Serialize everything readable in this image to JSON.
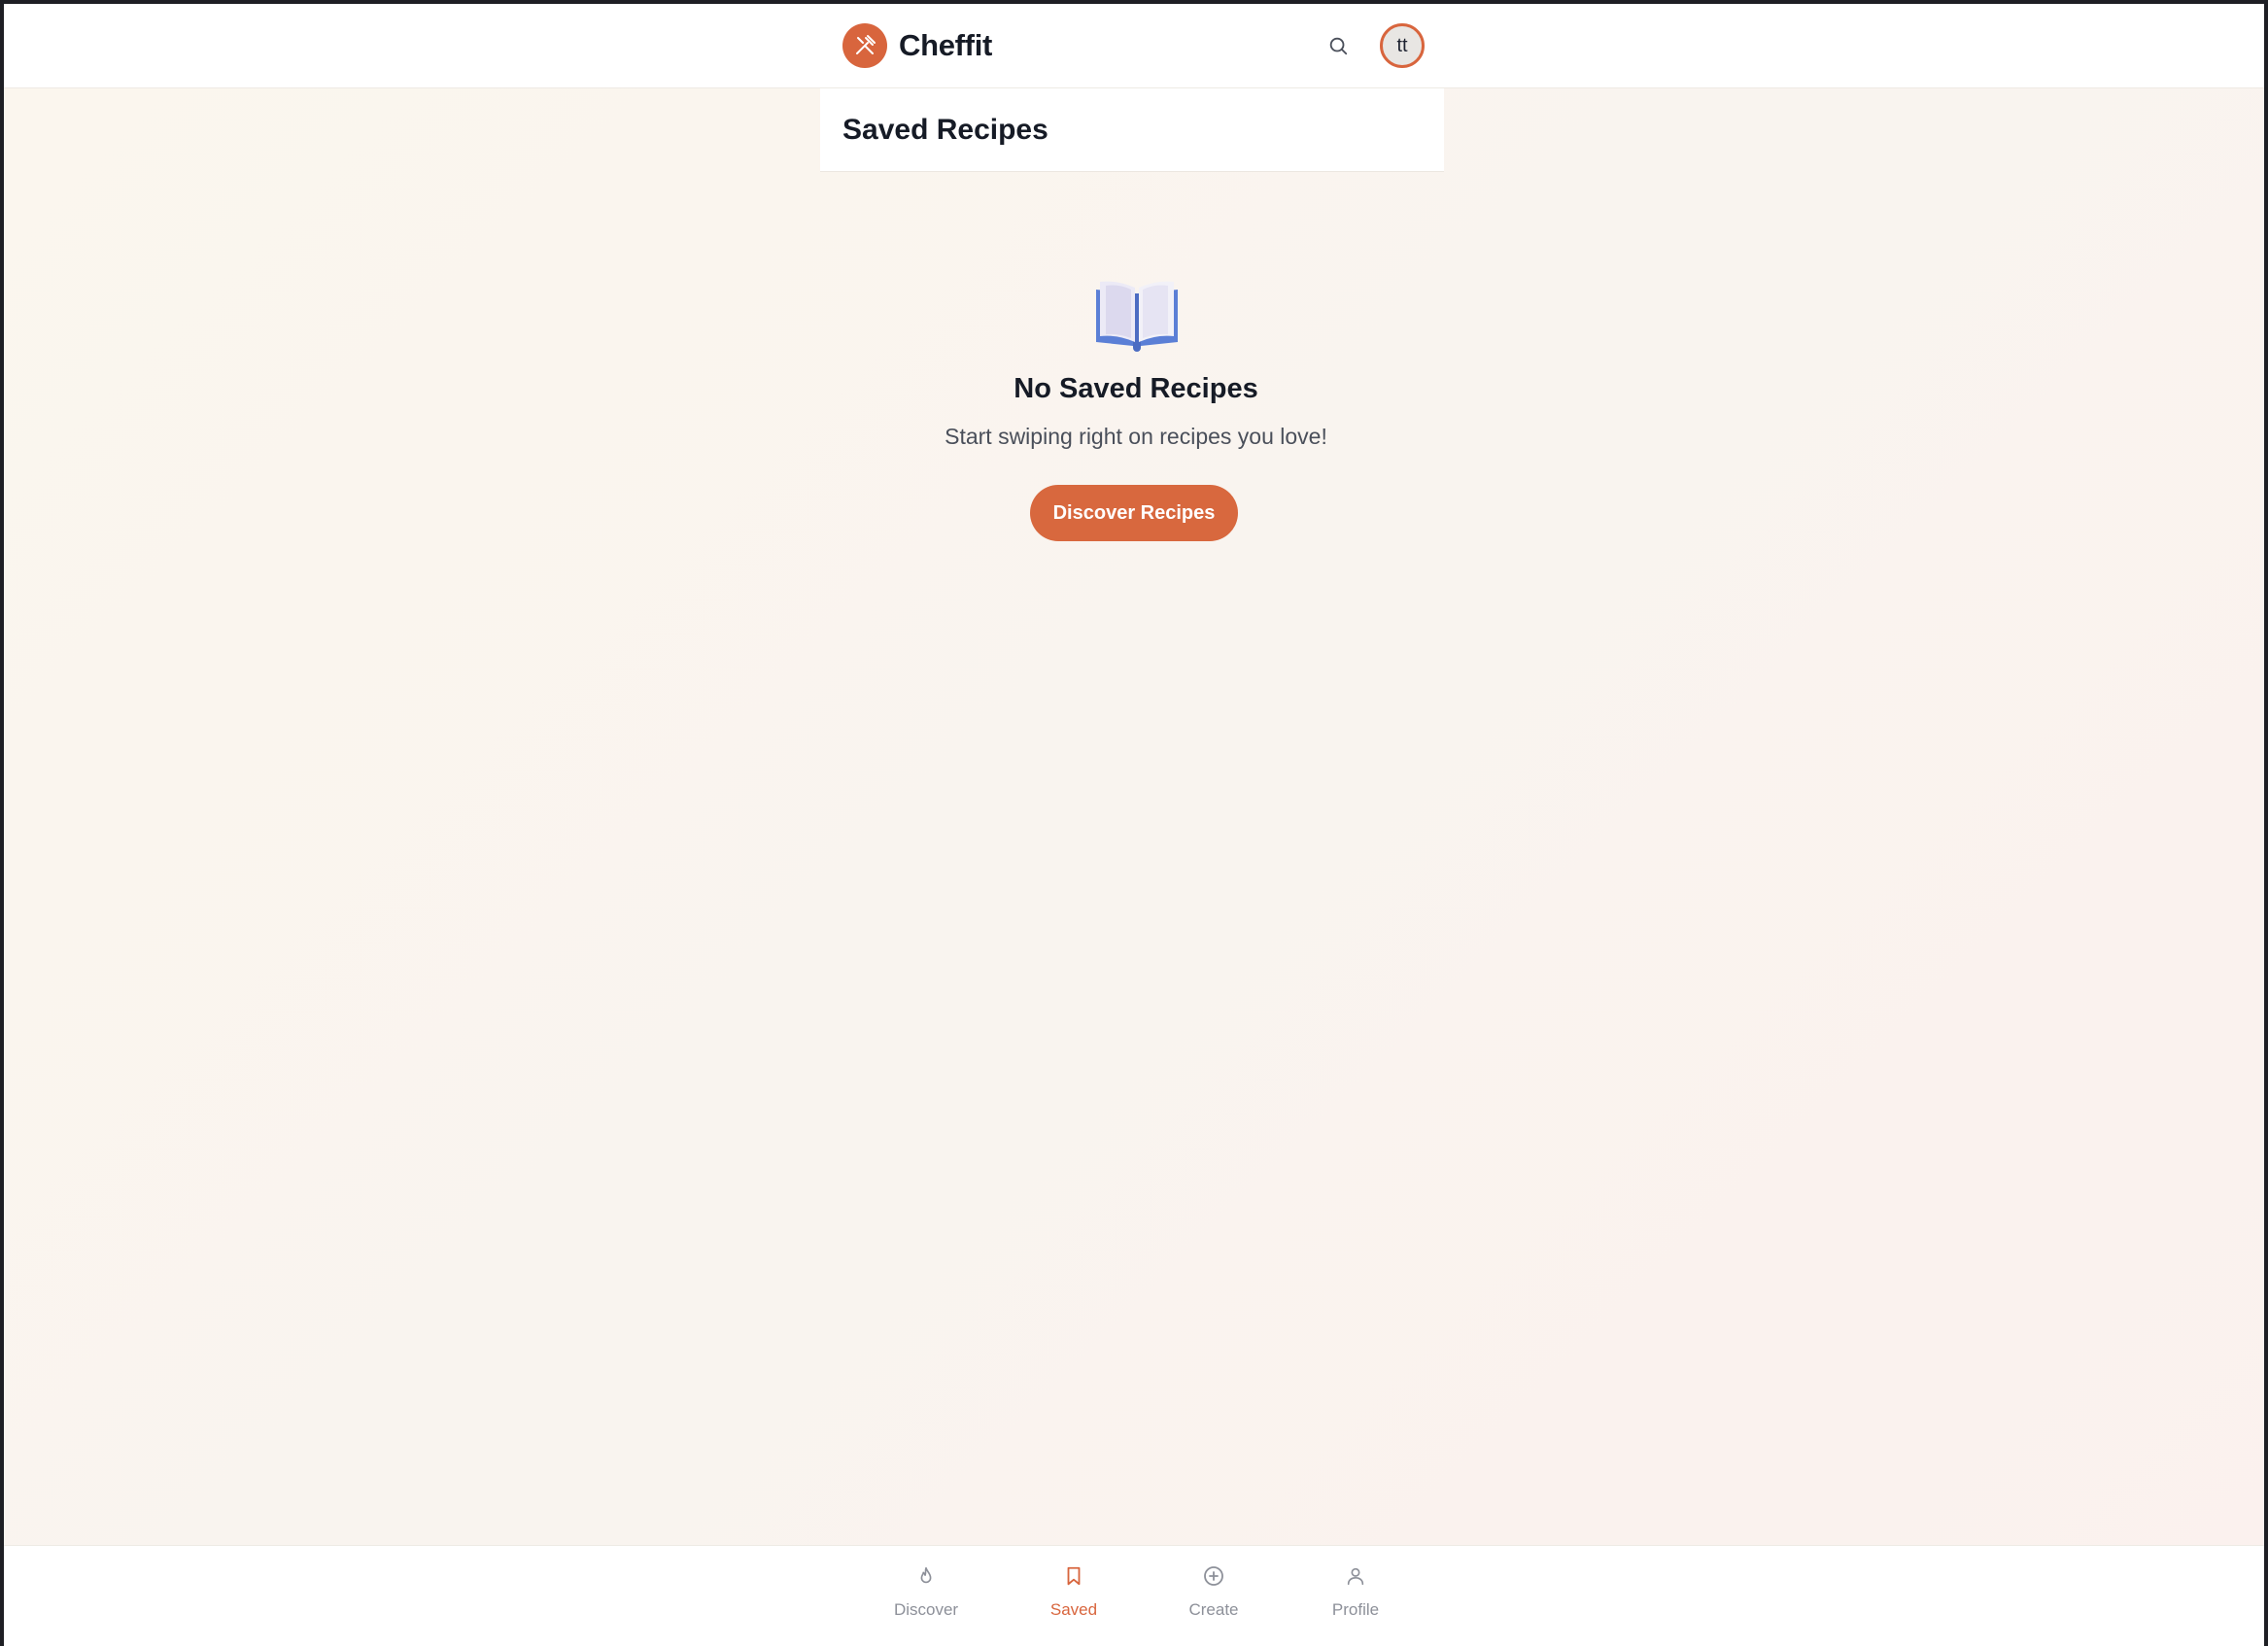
{
  "header": {
    "brand_name": "Cheffit",
    "brand_icon": "fork-knife-icon",
    "search_icon": "search-icon",
    "avatar_initials": "tt"
  },
  "page": {
    "title": "Saved Recipes"
  },
  "empty_state": {
    "icon": "open-book-icon",
    "heading": "No Saved Recipes",
    "subtext": "Start swiping right on recipes you love!",
    "button_label": "Discover Recipes"
  },
  "bottom_nav": {
    "items": [
      {
        "label": "Discover",
        "icon": "flame-icon",
        "active": false
      },
      {
        "label": "Saved",
        "icon": "bookmark-icon",
        "active": true
      },
      {
        "label": "Create",
        "icon": "plus-circle-icon",
        "active": false
      },
      {
        "label": "Profile",
        "icon": "user-icon",
        "active": false
      }
    ]
  },
  "colors": {
    "accent": "#d8653d",
    "text_primary": "#161b26",
    "text_muted": "#8d9099",
    "background": "#f9f4ef"
  }
}
